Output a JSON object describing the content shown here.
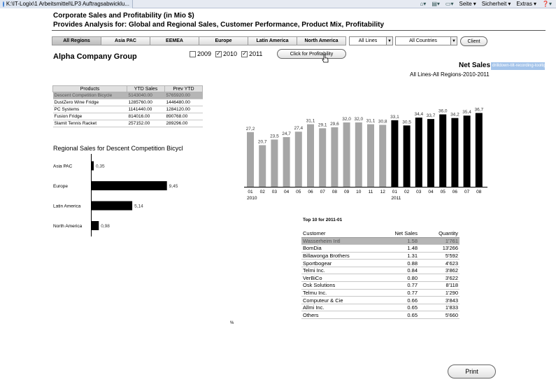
{
  "browser": {
    "tab_title": "K:\\IT-Logix\\1 Arbeitsmittel\\LP3 Auftragsabwicklu...",
    "menu": [
      "Seite",
      "Sicherheit",
      "Extras"
    ]
  },
  "header": {
    "title": "Corporate Sales and Profitability (in Mio $)",
    "subtitle": "Provides Analysis for: Global and Regional Sales, Customer Performance, Product Mix, Profitability"
  },
  "region_tabs": [
    "All Regions",
    "Asia PAC",
    "EEMEA",
    "Europe",
    "Latin America",
    "North America"
  ],
  "active_region": "All Regions",
  "filters": {
    "lines": "All Lines",
    "countries": "All Countries",
    "client_button": "Client"
  },
  "company": "Alpha Company Group",
  "years": [
    {
      "label": "2009",
      "checked": false
    },
    {
      "label": "2010",
      "checked": true
    },
    {
      "label": "2011",
      "checked": true
    }
  ],
  "profitability_button": "Click for Profitability",
  "net_sales": {
    "label": "Net Sales",
    "highlight_text": "drilldown-tilt-recording-tooltip",
    "subtitle": "All Lines-All Regions-2010-2011"
  },
  "products_table": {
    "headers": [
      "Products",
      "YTD Sales",
      "Prev YTD"
    ],
    "rows": [
      {
        "name": "Descent Competition Bicycle",
        "ytd": "5143040.00",
        "prev": "5765920.00",
        "selected": true
      },
      {
        "name": "DustZero Wine Fridge",
        "ytd": "1285760.00",
        "prev": "1446480.00",
        "selected": false
      },
      {
        "name": "PC Systems",
        "ytd": "1141440.00",
        "prev": "1284120.00",
        "selected": false
      },
      {
        "name": "Fusion Fridge",
        "ytd": "814016.00",
        "prev": "890768.00",
        "selected": false
      },
      {
        "name": "Slamit Tennis Racket",
        "ytd": "257152.00",
        "prev": "289296.00",
        "selected": false
      }
    ]
  },
  "regional_title": "Regional Sales for Descent Competition Bicycl",
  "percent_glyph": "%",
  "top10": {
    "title": "Top 10 for 2011-01",
    "headers": [
      "Customer",
      "Net Sales",
      "Quantity"
    ],
    "rows": [
      {
        "customer": "Wasserheim Intl",
        "net": "1.58",
        "qty": "1'761",
        "selected": true
      },
      {
        "customer": "BomDia",
        "net": "1.48",
        "qty": "13'266",
        "selected": false
      },
      {
        "customer": "Billawonga Brothers",
        "net": "1.31",
        "qty": "5'592",
        "selected": false
      },
      {
        "customer": "Sportbogear",
        "net": "0.88",
        "qty": "4'623",
        "selected": false
      },
      {
        "customer": "Telmi Inc.",
        "net": "0.84",
        "qty": "3'862",
        "selected": false
      },
      {
        "customer": "VerBiCo",
        "net": "0.80",
        "qty": "3'622",
        "selected": false
      },
      {
        "customer": "Osk Solutions",
        "net": "0.77",
        "qty": "8'118",
        "selected": false
      },
      {
        "customer": "Telmu Inc.",
        "net": "0.77",
        "qty": "1'290",
        "selected": false
      },
      {
        "customer": "Computeur & Cie",
        "net": "0.66",
        "qty": "3'843",
        "selected": false
      },
      {
        "customer": "Allmi Inc.",
        "net": "0.65",
        "qty": "1'833",
        "selected": false
      },
      {
        "customer": "Others",
        "net": "0.65",
        "qty": "5'660",
        "selected": false
      }
    ]
  },
  "print_button": "Print",
  "colors": {
    "grey_bar": "#a6a6a6",
    "black_bar": "#000000",
    "selected_row": "#b5b5b5",
    "highlight": "#a4c4ea"
  },
  "chart_data": [
    {
      "type": "bar",
      "title": "",
      "categories": [
        "01",
        "02",
        "03",
        "04",
        "05",
        "06",
        "07",
        "08",
        "09",
        "10",
        "11",
        "12",
        "01",
        "02",
        "03",
        "04",
        "05",
        "06",
        "07",
        "08"
      ],
      "year_labels": [
        "2010",
        "2011"
      ],
      "values": [
        27.2,
        20.7,
        23.5,
        24.7,
        27.4,
        31.1,
        29.1,
        29.6,
        32.0,
        32.0,
        31.1,
        30.8,
        33.1,
        30.5,
        34.4,
        33.7,
        36.0,
        34.2,
        35.4,
        36.7
      ],
      "value_labels": [
        "27,2",
        "20,7",
        "23,5",
        "24,7",
        "27,4",
        "31,1",
        "29,1",
        "29,6",
        "32,0",
        "32,0",
        "31,1",
        "30,8",
        "33,1",
        "30,5",
        "34,4",
        "33,7",
        "36,0",
        "34,2",
        "35,4",
        "36,7"
      ],
      "series_year": [
        "2010",
        "2010",
        "2010",
        "2010",
        "2010",
        "2010",
        "2010",
        "2010",
        "2010",
        "2010",
        "2010",
        "2010",
        "2011",
        "2011",
        "2011",
        "2011",
        "2011",
        "2011",
        "2011",
        "2011"
      ],
      "ylim": [
        0,
        40
      ],
      "grid": false
    },
    {
      "type": "bar",
      "orientation": "horizontal",
      "categories": [
        "Asia PAC",
        "Europe",
        "Latin America",
        "North America"
      ],
      "values": [
        0.35,
        9.45,
        5.14,
        0.98
      ],
      "value_labels": [
        "0,35",
        "9,45",
        "5,14",
        "0,98"
      ],
      "xlim": [
        0,
        10
      ]
    }
  ]
}
